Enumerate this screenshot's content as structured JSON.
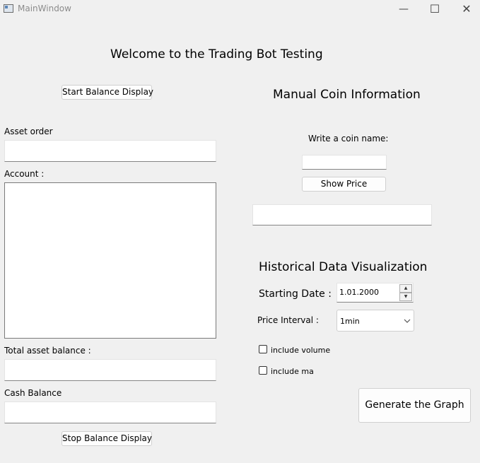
{
  "window": {
    "title": "MainWindow",
    "minimize_glyph": "—",
    "maximize_glyph": "☐",
    "close_glyph": "✕"
  },
  "welcome_text": "Welcome to the Trading Bot Testing",
  "left_panel": {
    "start_button": "Start Balance Display",
    "asset_order_label": "Asset order",
    "asset_order_value": "",
    "account_label": "Account :",
    "account_value": "",
    "total_asset_label": "Total asset balance :",
    "total_asset_value": "",
    "cash_balance_label": "Cash Balance",
    "cash_balance_value": "",
    "stop_button": "Stop Balance Display"
  },
  "manual_coin": {
    "heading": "Manual Coin Information",
    "prompt": "Write a coin name:",
    "coin_value": "",
    "show_price_button": "Show Price",
    "price_output": ""
  },
  "historical": {
    "heading": "Historical Data Visualization",
    "start_date_label": "Starting Date :",
    "start_date_value": "1.01.2000",
    "interval_label": "Price Interval :",
    "interval_value": "1min",
    "include_volume_label": "include volume",
    "include_volume_checked": false,
    "include_ma_label": "include ma",
    "include_ma_checked": false,
    "generate_button": "Generate the Graph"
  },
  "icons": {
    "app": "app-window-icon",
    "spin_up": "▲",
    "spin_down": "▼",
    "dropdown": "chevron-down-icon"
  }
}
